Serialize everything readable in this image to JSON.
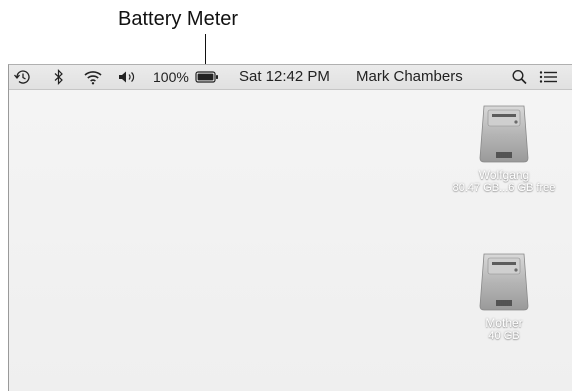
{
  "callout": {
    "label": "Battery Meter"
  },
  "menubar": {
    "icons": [
      "time-machine-icon",
      "bluetooth-icon",
      "wifi-icon",
      "volume-icon",
      "battery-icon",
      "spotlight-search-icon",
      "notification-center-icon"
    ],
    "battery_percent": "100%",
    "battery_level": 1.0,
    "clock": "Sat 12:42 PM",
    "user": "Mark Chambers"
  },
  "desktop": {
    "disks": [
      {
        "name": "Wolfgang",
        "info": "80.47 GB...6 GB free"
      },
      {
        "name": "Mother",
        "info": "40 GB"
      }
    ]
  }
}
